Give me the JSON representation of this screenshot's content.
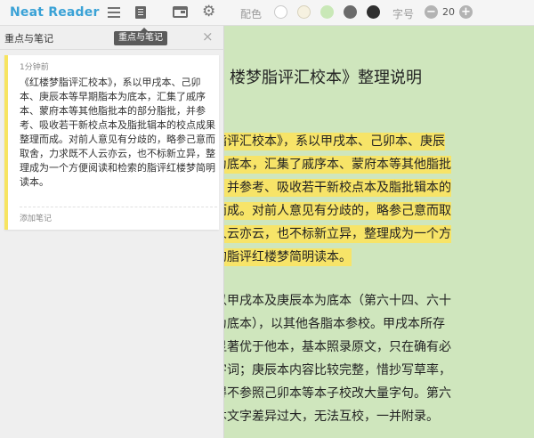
{
  "toolbar": {
    "app_title": "Neat Reader",
    "color_label": "配色",
    "font_size_label": "字号",
    "font_size_value": "20",
    "decrease_symbol": "−",
    "increase_symbol": "+",
    "icons": [
      "menu-icon",
      "notes-icon",
      "display-icon",
      "gear-icon"
    ],
    "swatches": [
      "#ffffff",
      "#f6f1e0",
      "#c9e8b7",
      "#6b6b6b",
      "#2f2f2f"
    ]
  },
  "notes_panel": {
    "title": "重点与笔记",
    "tooltip": "重点与笔记",
    "close_symbol": "×",
    "note": {
      "time": "1分钟前",
      "text": "《红楼梦脂评汇校本》，系以甲戌本、己卯本、庚辰本等早期脂本为底本，汇集了戚序本、蒙府本等其他脂批本的部分脂批，并参考、吸收若干新校点本及脂批辑本的校点成果整理而成。对前人意见有分歧的，略参己意而取舍，力求既不人云亦云，也不标新立异，整理成为一个方便阅读和检索的脂评红楼梦简明读本。",
      "add_note_label": "添加笔记",
      "highlight_color": "#f7e460"
    }
  },
  "reader": {
    "background": "#cfe6bd",
    "highlight_color": "#f7e468",
    "heading": "楼梦脂评汇校本》整理说明",
    "paragraph1": [
      "脂评汇校本》，系以甲戌本、己卯本、庚辰",
      "为底本，汇集了戚序本、蒙府本等其他脂批",
      "，并参考、吸收若干新校点本及脂批辑本的",
      "而成。对前人意见有分歧的，略参己意而取",
      "人云亦云，也不标新立异，整理成为一个方",
      "的脂评红楼梦简明读本。"
    ],
    "paragraph2": [
      "以甲戌本及庚辰本为底本（第六十四、六十",
      "为底本），以其他各脂本参校。甲戌本所存",
      "显著优于他本，基本照录原文，只在确有必",
      "字词；庚辰本内容比较完整，惜抄写草率，",
      "得不参照己卯本等本子校改大量字句。第六",
      "本文字差异过大，无法互校，一并附录。"
    ]
  }
}
